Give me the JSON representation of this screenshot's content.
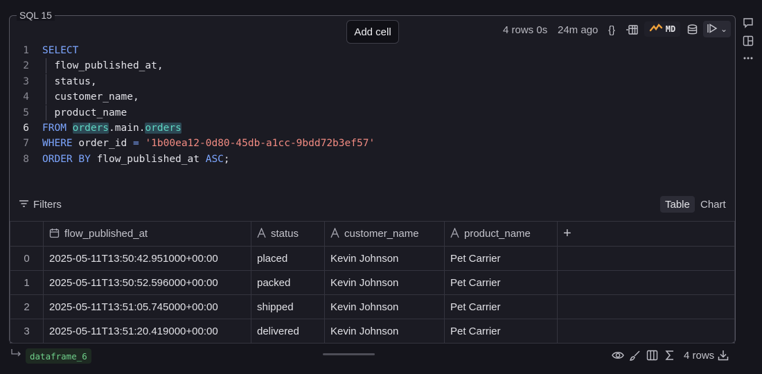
{
  "cell": {
    "label": "SQL 15"
  },
  "tooltip": {
    "text": "Add cell"
  },
  "meta": {
    "rows_time": "4 rows 0s",
    "ago": "24m ago",
    "braces_icon": "{}",
    "md_label": "MD",
    "icons": [
      "braces-icon",
      "table-schema-icon",
      "transform-icon",
      "database-icon",
      "run-icon",
      "chevron-down-icon"
    ]
  },
  "code": {
    "lines": [
      {
        "n": "1",
        "tokens": [
          {
            "t": "SELECT",
            "c": "kw"
          }
        ]
      },
      {
        "n": "2",
        "tokens": [
          {
            "t": "  flow_published_at,",
            "c": ""
          }
        ]
      },
      {
        "n": "3",
        "tokens": [
          {
            "t": "  status,",
            "c": ""
          }
        ]
      },
      {
        "n": "4",
        "tokens": [
          {
            "t": "  customer_name,",
            "c": ""
          }
        ]
      },
      {
        "n": "5",
        "tokens": [
          {
            "t": "  product_name",
            "c": ""
          }
        ]
      },
      {
        "n": "6",
        "tokens": [
          {
            "t": "FROM",
            "c": "kw"
          },
          {
            "t": " ",
            "c": ""
          },
          {
            "t": "orders",
            "c": "hl"
          },
          {
            "t": ".main.",
            "c": ""
          },
          {
            "t": "orders",
            "c": "hl"
          }
        ]
      },
      {
        "n": "7",
        "tokens": [
          {
            "t": "WHERE",
            "c": "kw"
          },
          {
            "t": " order_id ",
            "c": ""
          },
          {
            "t": "=",
            "c": "kw"
          },
          {
            "t": " ",
            "c": ""
          },
          {
            "t": "'1b00ea12-0d80-45db-a1cc-9bdd72b3ef57'",
            "c": "str"
          }
        ]
      },
      {
        "n": "8",
        "tokens": [
          {
            "t": "ORDER BY",
            "c": "kw"
          },
          {
            "t": " flow_published_at ",
            "c": ""
          },
          {
            "t": "ASC",
            "c": "kw"
          },
          {
            "t": ";",
            "c": ""
          }
        ]
      }
    ],
    "active_line": "6"
  },
  "toolbar": {
    "filters_label": "Filters",
    "table_tab": "Table",
    "chart_tab": "Chart"
  },
  "table": {
    "columns": [
      {
        "name": "flow_published_at",
        "icon": "calendar-icon"
      },
      {
        "name": "status",
        "icon": "text-type-icon"
      },
      {
        "name": "customer_name",
        "icon": "text-type-icon"
      },
      {
        "name": "product_name",
        "icon": "text-type-icon"
      }
    ],
    "add_column": "+",
    "rows": [
      {
        "idx": "0",
        "flow_published_at": "2025-05-11T13:50:42.951000+00:00",
        "status": "placed",
        "customer_name": "Kevin Johnson",
        "product_name": "Pet Carrier"
      },
      {
        "idx": "1",
        "flow_published_at": "2025-05-11T13:50:52.596000+00:00",
        "status": "packed",
        "customer_name": "Kevin Johnson",
        "product_name": "Pet Carrier"
      },
      {
        "idx": "2",
        "flow_published_at": "2025-05-11T13:51:05.745000+00:00",
        "status": "shipped",
        "customer_name": "Kevin Johnson",
        "product_name": "Pet Carrier"
      },
      {
        "idx": "3",
        "flow_published_at": "2025-05-11T13:51:20.419000+00:00",
        "status": "delivered",
        "customer_name": "Kevin Johnson",
        "product_name": "Pet Carrier"
      }
    ]
  },
  "footer": {
    "dataframe": "dataframe_6",
    "rows": "4 rows"
  }
}
